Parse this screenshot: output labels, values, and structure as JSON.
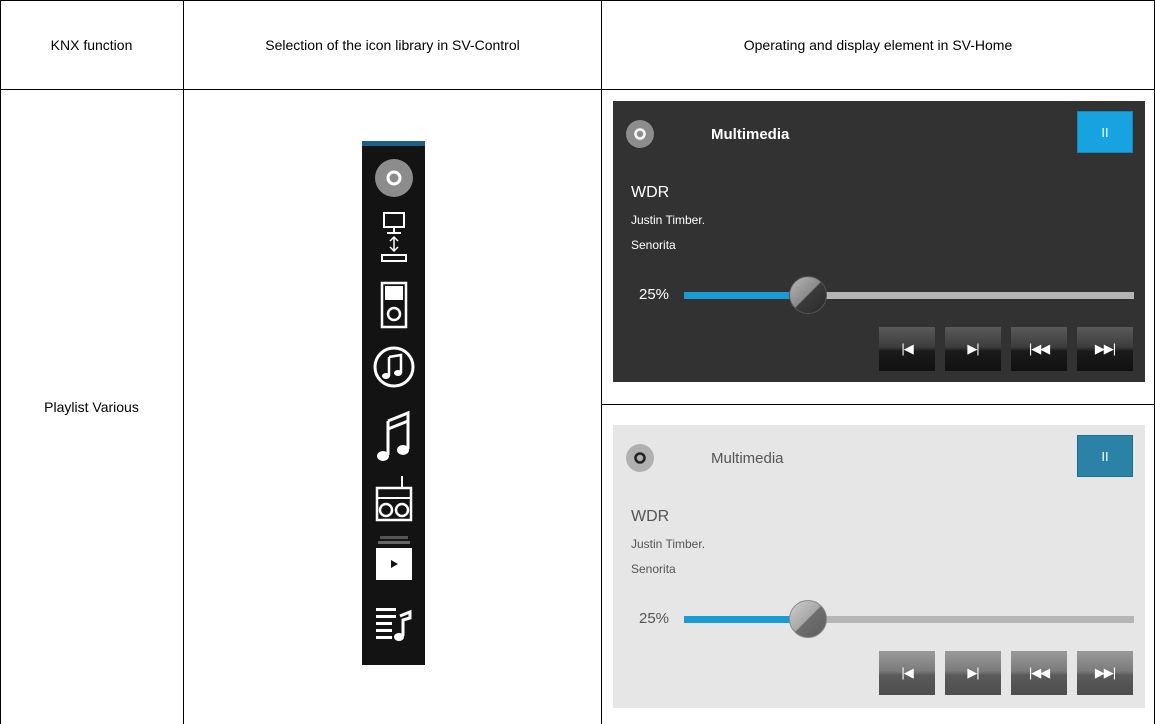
{
  "table": {
    "headers": [
      "KNX function",
      "Selection of the icon library in SV-Control",
      "Operating and display element in SV-Home"
    ],
    "row_label": "Playlist Various"
  },
  "icon_library": {
    "icons": [
      "disc-icon",
      "network-pc-icon",
      "ipod-icon",
      "music-note-circle-icon",
      "music-notes-icon",
      "radio-icon",
      "video-player-icon",
      "playlist-icon"
    ]
  },
  "panels": {
    "dark": {
      "title": "Multimedia",
      "pause_label": "II",
      "station": "WDR",
      "artist": "Justin Timber.",
      "track": "Senorita",
      "volume_label": "25%",
      "volume_fraction": 0.25,
      "controls": [
        "|◀",
        "▶|",
        "|◀◀",
        "▶▶|"
      ],
      "accent": "#17a3df"
    },
    "light": {
      "title": "Multimedia",
      "pause_label": "II",
      "station": "WDR",
      "artist": "Justin Timber.",
      "track": "Senorita",
      "volume_label": "25%",
      "volume_fraction": 0.25,
      "controls": [
        "|◀",
        "▶|",
        "|◀◀",
        "▶▶|"
      ],
      "accent": "#2a82a6"
    }
  }
}
